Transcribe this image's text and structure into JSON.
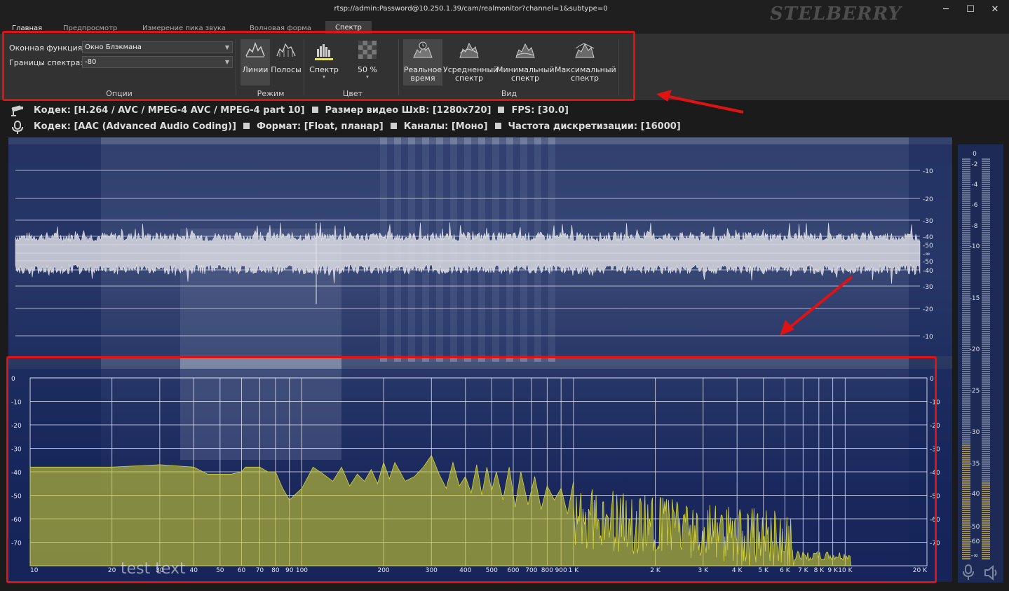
{
  "window": {
    "title": "rtsp://admin:Password@10.250.1.39/cam/realmonitor?channel=1&subtype=0",
    "brand": "STELBERRY",
    "btn_min": "─",
    "btn_max": "☐",
    "btn_close": "✕"
  },
  "tabs": [
    {
      "label": "Главная"
    },
    {
      "label": "Предпросмотр"
    },
    {
      "label": "Измерение пика звука"
    },
    {
      "label": "Волновая форма"
    },
    {
      "label": "Спектр"
    }
  ],
  "options": {
    "window_fn_label": "Оконная функция:",
    "window_fn_value": "Окно Блэкмана",
    "bounds_label": "Границы спектра:",
    "bounds_value": "-80",
    "caption": "Опции"
  },
  "mode": {
    "lines": "Линии",
    "bars": "Полосы",
    "caption": "Режим"
  },
  "color": {
    "spectrum": "Спектр",
    "opacity": "50 %",
    "caption": "Цвет"
  },
  "view": {
    "realtime_1": "Реальное",
    "realtime_2": "время",
    "avg_1": "Усредненный",
    "avg_2": "спектр",
    "min_1": "Минимальный",
    "min_2": "спектр",
    "max_1": "Максимальный",
    "max_2": "спектр",
    "caption": "Вид"
  },
  "info": {
    "video": [
      {
        "label": "Кодек:",
        "value": "[H.264 / AVC / MPEG-4 AVC / MPEG-4 part 10]"
      },
      {
        "label": "Размер видео ШхВ:",
        "value": "[1280x720]"
      },
      {
        "label": "FPS:",
        "value": "[30.0]"
      }
    ],
    "audio": [
      {
        "label": "Кодек:",
        "value": "[AAC (Advanced Audio Coding)]"
      },
      {
        "label": "Формат:",
        "value": "[Float, планар]"
      },
      {
        "label": "Каналы:",
        "value": "[Моно]"
      },
      {
        "label": "Частота дискретизации:",
        "value": "[16000]"
      }
    ]
  },
  "waveform": {
    "db_labels": [
      "-10",
      "-20",
      "-30",
      "-40",
      "-50",
      "-∞",
      "-50",
      "-40",
      "-30",
      "-20",
      "-10"
    ]
  },
  "spectrum": {
    "y_labels": [
      "0",
      "-10",
      "-20",
      "-30",
      "-40",
      "-50",
      "-60",
      "-70"
    ],
    "x_labels": [
      "10",
      "20",
      "30",
      "40",
      "50",
      "60",
      "70",
      "80",
      "90",
      "100",
      "200",
      "300",
      "400",
      "500",
      "600",
      "700",
      "800",
      "900",
      "1 K",
      "2 K",
      "3 K",
      "4 K",
      "5 K",
      "6 K",
      "7 K",
      "8 K",
      "9 K",
      "10 K",
      "20 K"
    ],
    "overlay_text": "test text",
    "fill_color": "#c8c832"
  },
  "meter": {
    "labels": [
      "0",
      "-2",
      "-4",
      "-6",
      "-8",
      "-10",
      "-15",
      "-20",
      "-25",
      "-30",
      "-35",
      "-40",
      "-50",
      "-60",
      "-∞"
    ]
  },
  "colors": {
    "highlight": "#e01212",
    "accent": "#f2ea30"
  }
}
